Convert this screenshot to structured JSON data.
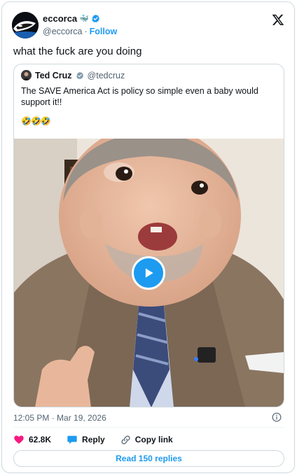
{
  "author": {
    "display_name": "eccorca",
    "handle": "@eccorca",
    "follow_label": "Follow",
    "separator": "·",
    "badge_emoji": "🐳"
  },
  "tweet": {
    "text": "what the fuck are you doing",
    "timestamp": "12:05 PM · Mar 19, 2026"
  },
  "quote": {
    "display_name": "Ted Cruz",
    "handle": "@tedcruz",
    "text": "The SAVE America Act is policy so simple even a baby would support it!!",
    "emoji": "🤣🤣🤣"
  },
  "engagement": {
    "likes": "62.8K",
    "reply_label": "Reply",
    "copy_label": "Copy link",
    "read_replies_label": "Read 150 replies"
  },
  "colors": {
    "accent": "#1d9bf0",
    "like": "#f91880",
    "text": "#0f1419",
    "muted": "#536471",
    "border": "#cfd9de"
  },
  "icons": [
    "orca-avatar",
    "whale-badge",
    "verified-badge",
    "x-logo",
    "play-icon",
    "info-icon",
    "heart-icon",
    "reply-bubble-icon",
    "link-icon"
  ]
}
